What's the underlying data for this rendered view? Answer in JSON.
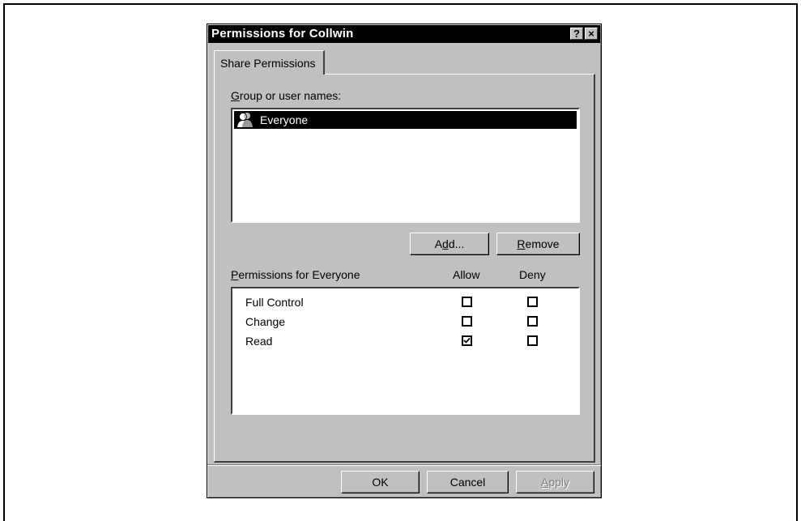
{
  "dialog": {
    "title": "Permissions for Collwin",
    "help_label": "?",
    "close_label": "×"
  },
  "tabs": [
    {
      "label": "Share Permissions",
      "active": true
    }
  ],
  "group_section": {
    "label_prefix": "",
    "label_mnemonic": "G",
    "label_rest": "roup or user names:",
    "items": [
      {
        "name": "Everyone",
        "icon": "group-icon",
        "selected": true
      }
    ]
  },
  "buttons": {
    "add": {
      "mnemonic_pre": "A",
      "mnemonic": "d",
      "rest": "d..."
    },
    "remove": {
      "mnemonic": "R",
      "rest": "emove"
    },
    "ok": "OK",
    "cancel": "Cancel",
    "apply": {
      "mnemonic": "A",
      "rest": "pply",
      "disabled": true
    }
  },
  "permissions": {
    "label_mnemonic": "P",
    "label_rest": "ermissions for Everyone",
    "allow_header": "Allow",
    "deny_header": "Deny",
    "rows": [
      {
        "name": "Full Control",
        "allow": false,
        "deny": false
      },
      {
        "name": "Change",
        "allow": false,
        "deny": false
      },
      {
        "name": "Read",
        "allow": true,
        "deny": false
      }
    ]
  },
  "colors": {
    "titlebar": "#000000",
    "face": "#c0c0c0",
    "selection": "#000000"
  }
}
